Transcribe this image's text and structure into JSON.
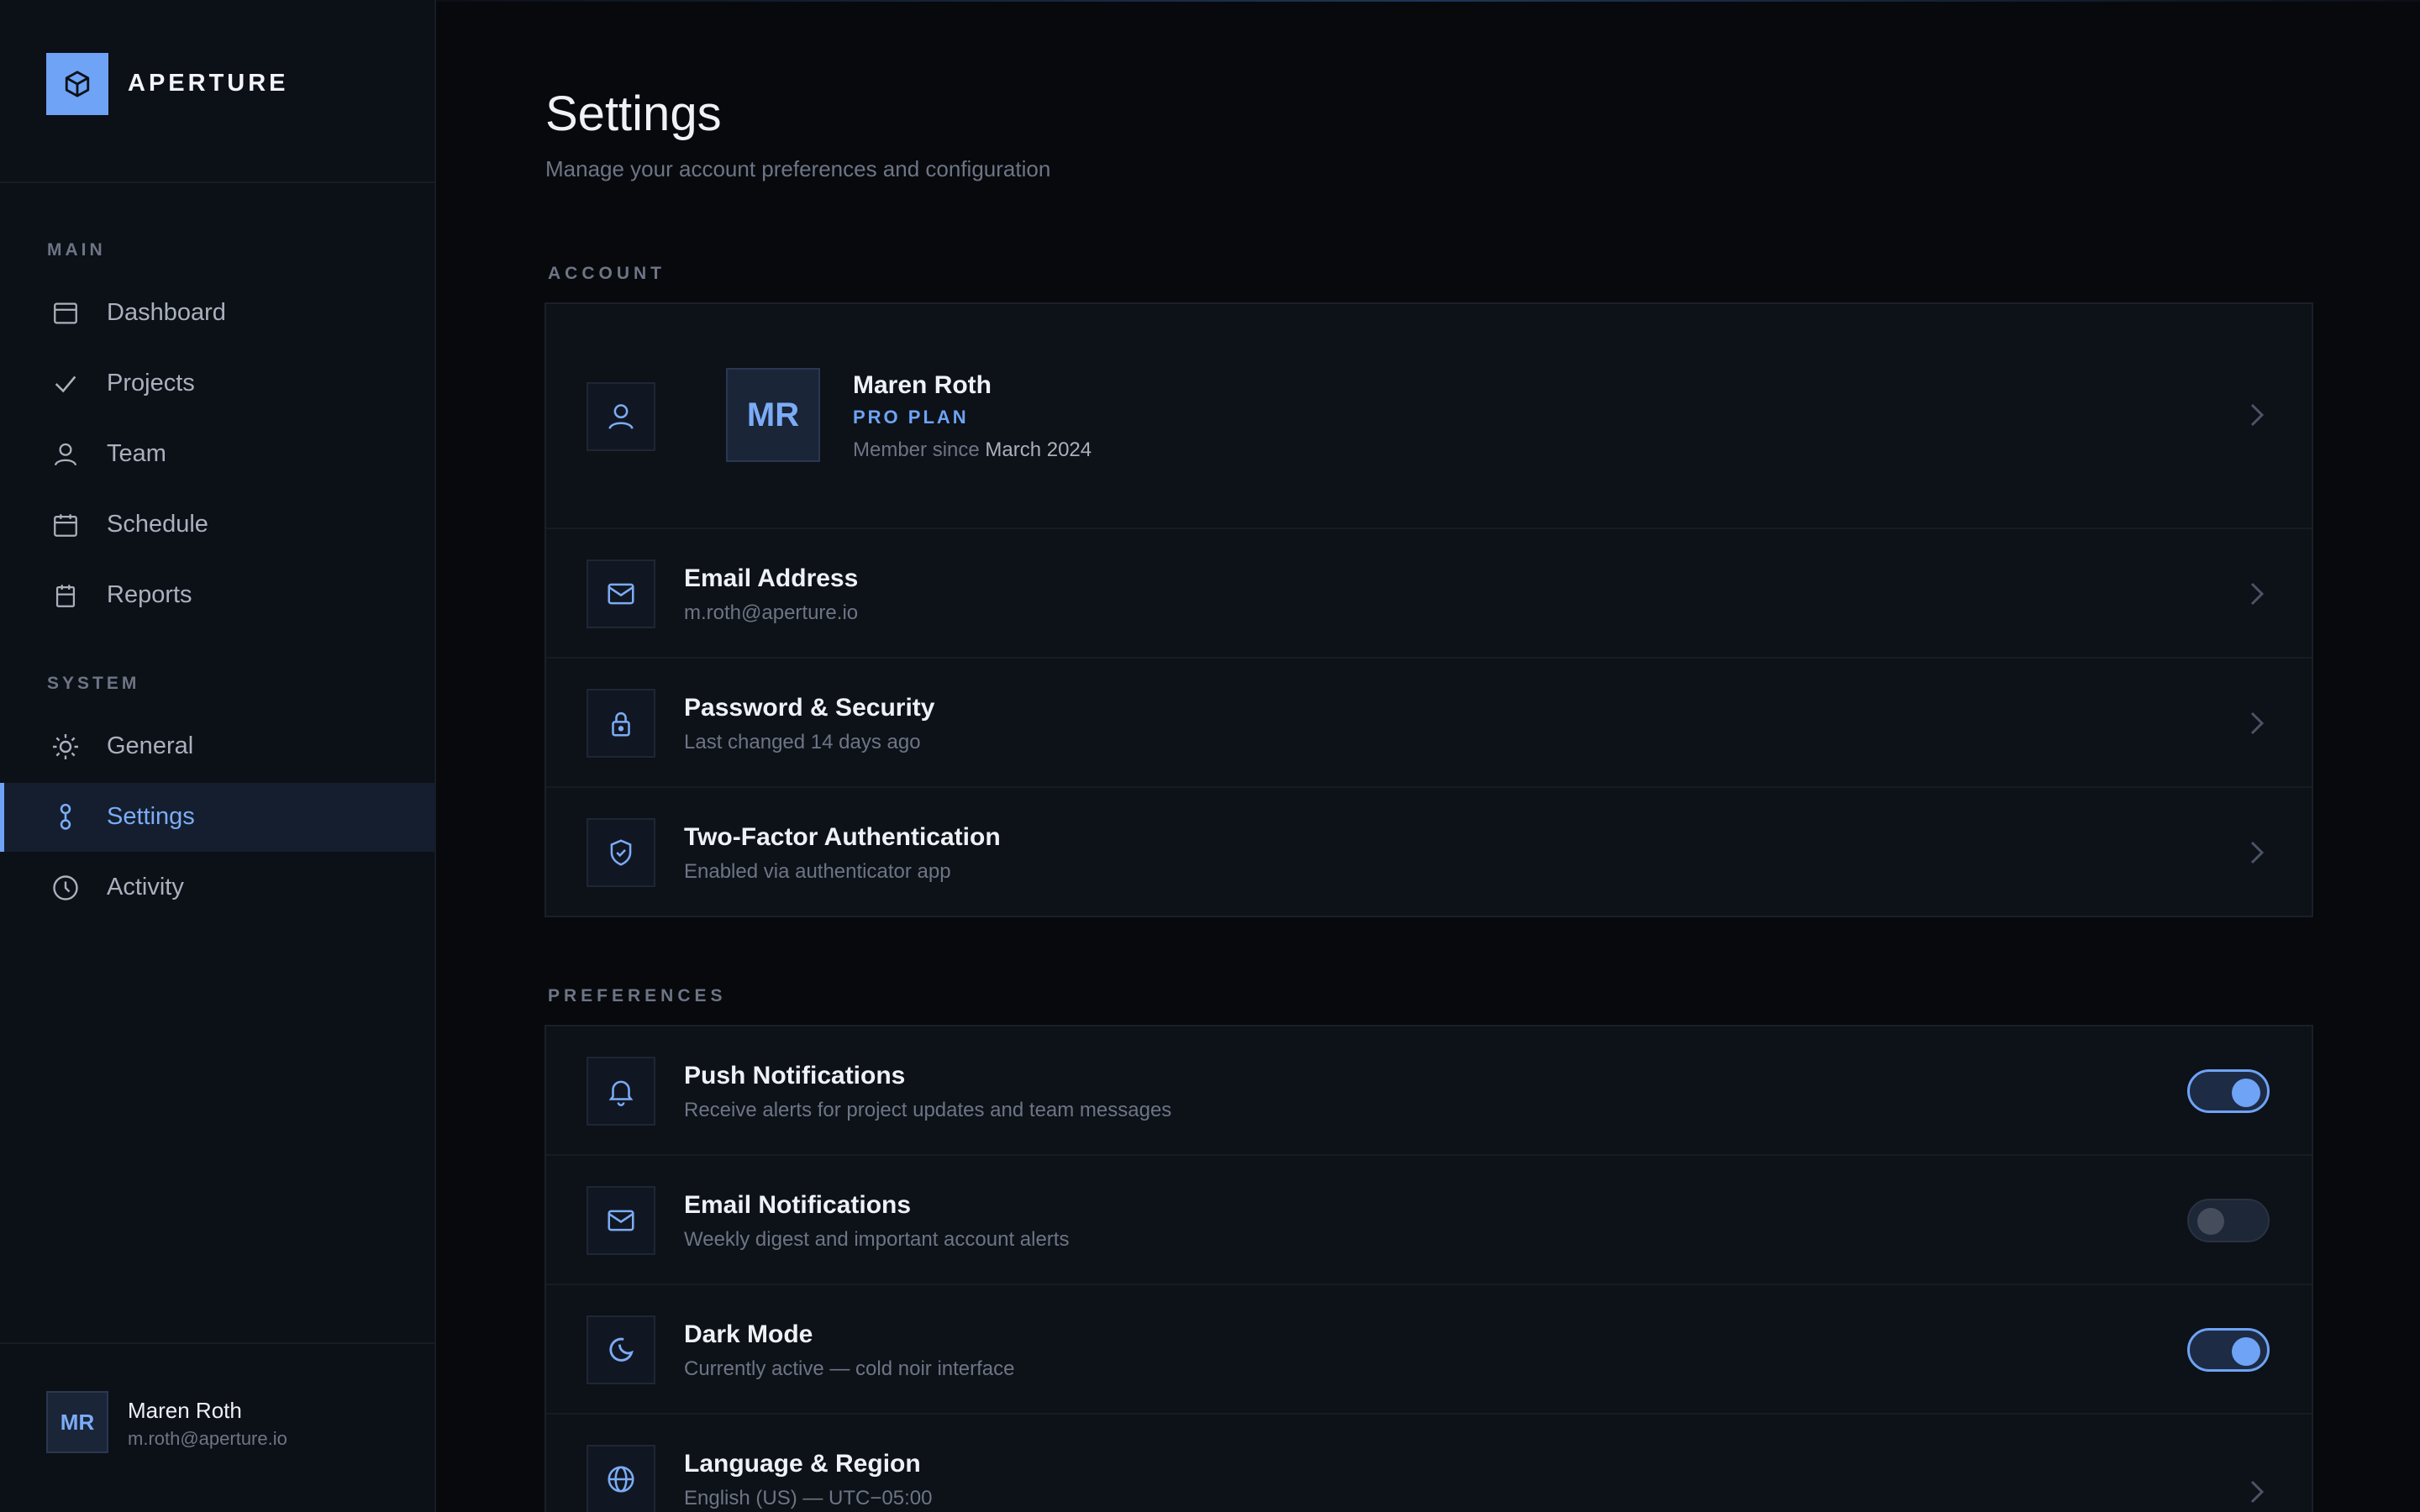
{
  "brand": {
    "name": "APERTURE"
  },
  "nav": {
    "sections": [
      {
        "label": "MAIN"
      },
      {
        "label": "SYSTEM"
      }
    ],
    "items": [
      {
        "label": "Dashboard",
        "icon": "dashboard-icon"
      },
      {
        "label": "Projects",
        "icon": "check-icon"
      },
      {
        "label": "Team",
        "icon": "user-icon"
      },
      {
        "label": "Schedule",
        "icon": "calendar-icon"
      },
      {
        "label": "Reports",
        "icon": "report-icon"
      },
      {
        "label": "General",
        "icon": "sun-icon"
      },
      {
        "label": "Settings",
        "icon": "settings-icon",
        "active": true
      },
      {
        "label": "Activity",
        "icon": "clock-icon"
      }
    ]
  },
  "footer_user": {
    "initials": "MR",
    "name": "Maren Roth",
    "email": "m.roth@aperture.io"
  },
  "page": {
    "title": "Settings",
    "subtitle": "Manage your account preferences and configuration"
  },
  "account": {
    "label": "ACCOUNT",
    "profile": {
      "initials": "MR",
      "name": "Maren Roth",
      "plan": "PRO PLAN",
      "since_prefix": "Member since",
      "since_value": "March 2024"
    },
    "rows": [
      {
        "title": "Email Address",
        "sub": "m.roth@aperture.io",
        "icon": "mail-icon"
      },
      {
        "title": "Password & Security",
        "sub": "Last changed 14 days ago",
        "icon": "lock-icon"
      },
      {
        "title": "Two-Factor Authentication",
        "sub": "Enabled via authenticator app",
        "icon": "shield-icon"
      }
    ]
  },
  "preferences": {
    "label": "PREFERENCES",
    "rows": [
      {
        "title": "Push Notifications",
        "sub": "Receive alerts for project updates and team messages",
        "icon": "bell-icon",
        "toggle": true
      },
      {
        "title": "Email Notifications",
        "sub": "Weekly digest and important account alerts",
        "icon": "mail-icon",
        "toggle": false
      },
      {
        "title": "Dark Mode",
        "sub": "Currently active — cold noir interface",
        "icon": "moon-icon",
        "toggle": true
      },
      {
        "title": "Language & Region",
        "sub": "English (US) — UTC−05:00",
        "icon": "globe-icon"
      }
    ]
  },
  "colors": {
    "accent": "#6ea3f5",
    "background": "#07090d",
    "sidebar": "#0c1017"
  }
}
